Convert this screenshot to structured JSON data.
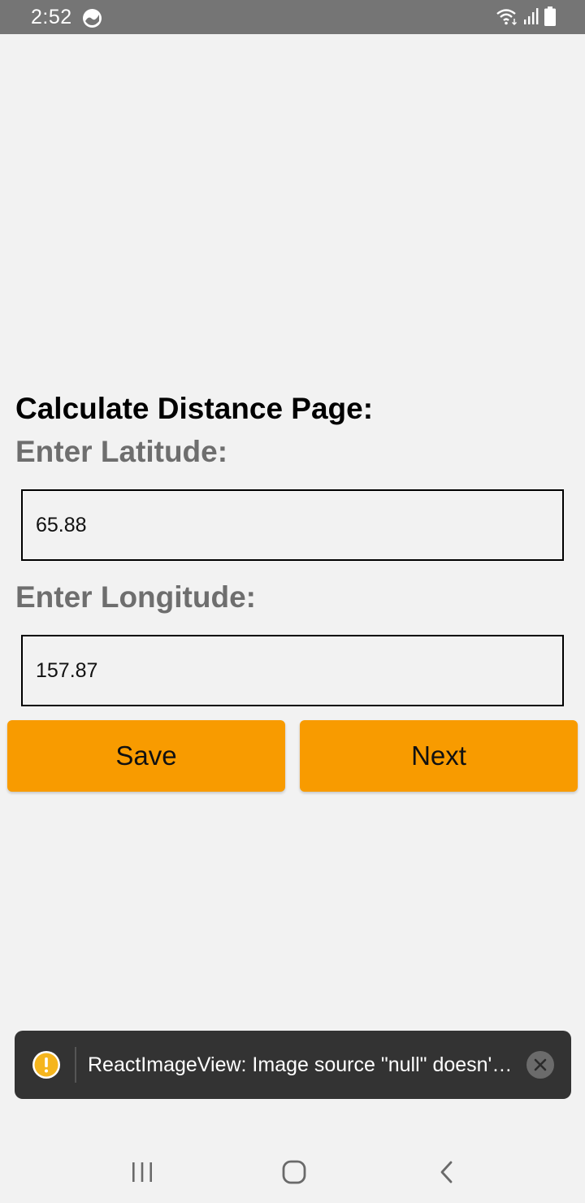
{
  "status_bar": {
    "time": "2:52",
    "icons": [
      "app-notification-icon",
      "wifi-icon",
      "signal-icon",
      "battery-icon"
    ]
  },
  "page": {
    "title": "Calculate Distance Page:",
    "latitude_label": "Enter Latitude:",
    "latitude_value": "65.88",
    "longitude_label": "Enter Longitude:",
    "longitude_value": "157.87"
  },
  "buttons": {
    "save_label": "Save",
    "next_label": "Next"
  },
  "toast": {
    "message": "ReactImageView: Image source \"null\" doesn't exist",
    "icon": "warning-icon"
  },
  "nav_bar": {
    "icons": [
      "recents-icon",
      "home-icon",
      "back-icon"
    ]
  },
  "colors": {
    "background": "#f2f2f2",
    "status_bar": "#757575",
    "accent_button": "#f89b00",
    "label_gray": "#6e6e6e",
    "toast_background": "#333333",
    "warning_yellow": "#f5b51d"
  }
}
